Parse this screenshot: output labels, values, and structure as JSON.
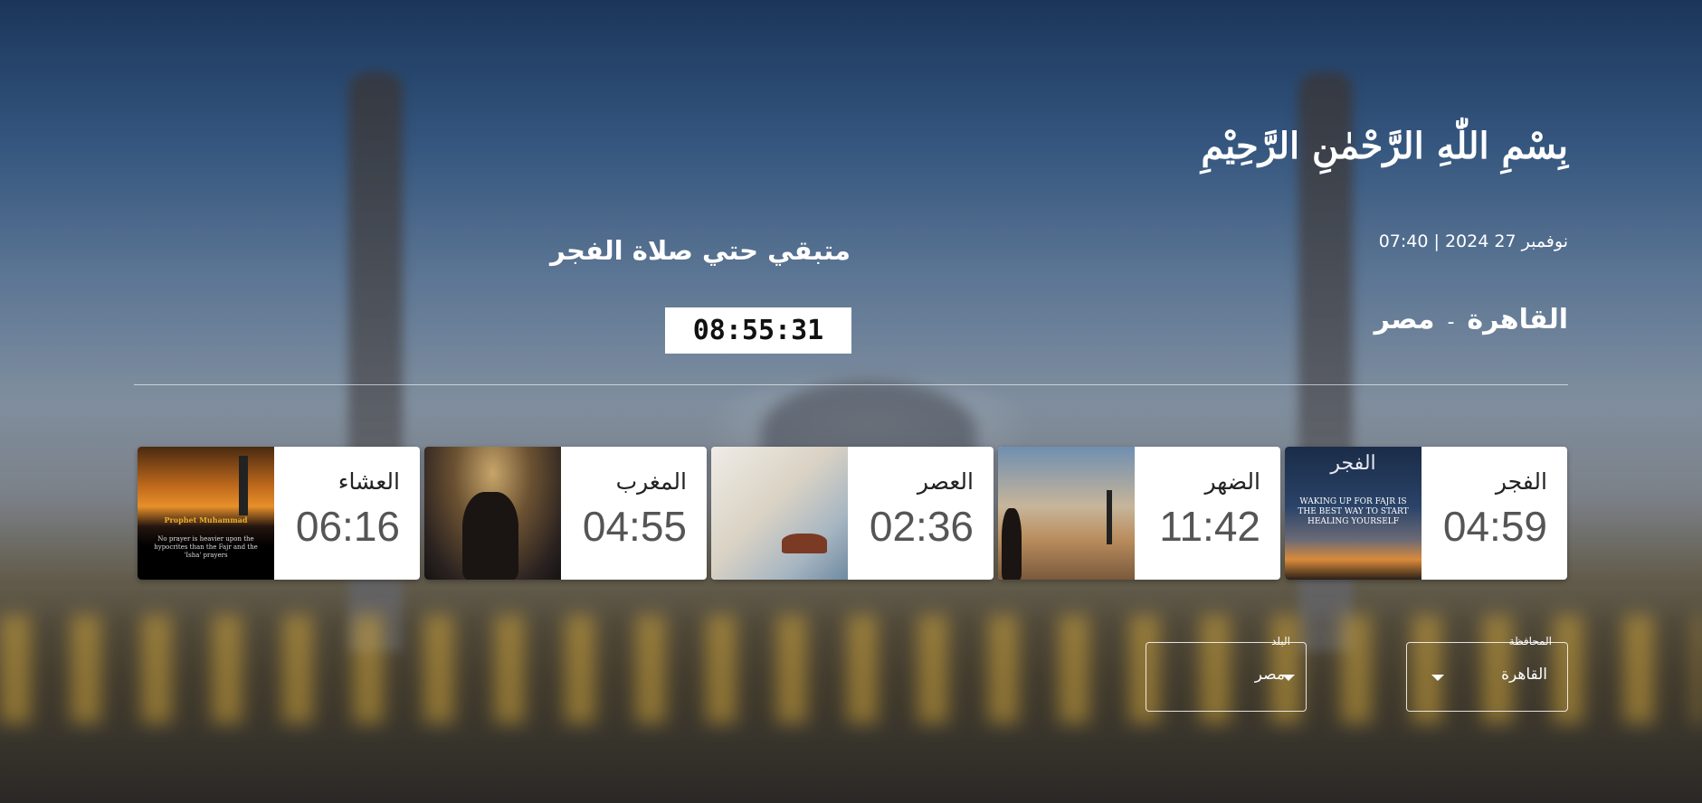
{
  "header": {
    "bismillah": "بِسْمِ اللّٰهِ الرَّحْمٰنِ الرَّحِيْمِ",
    "datetime": "نوفمبر 27 2024 | 07:40",
    "city": "القاهرة",
    "separator": "-",
    "country": "مصر"
  },
  "countdown": {
    "label": "متبقي حتي صلاة الفجر",
    "value": "08:55:31"
  },
  "prayers": [
    {
      "name": "الفجر",
      "time": "04:59",
      "image_title": "الفجر",
      "image_caption": "WAKING UP FOR FAJR IS THE BEST WAY TO START HEALING YOURSELF"
    },
    {
      "name": "الضهر",
      "time": "11:42"
    },
    {
      "name": "العصر",
      "time": "02:36"
    },
    {
      "name": "المغرب",
      "time": "04:55"
    },
    {
      "name": "العشاء",
      "time": "06:16",
      "image_title": "Prophet Muhammad",
      "image_caption": "No prayer is heavier upon the hypocrites than the Fajr and the 'Isha' prayers"
    }
  ],
  "selects": {
    "governorate": {
      "label": "المحافظة",
      "value": "القاهرة"
    },
    "country": {
      "label": "البلد",
      "value": "مصر"
    }
  },
  "icons": {
    "dropdown_arrow": "caret-down-icon"
  }
}
